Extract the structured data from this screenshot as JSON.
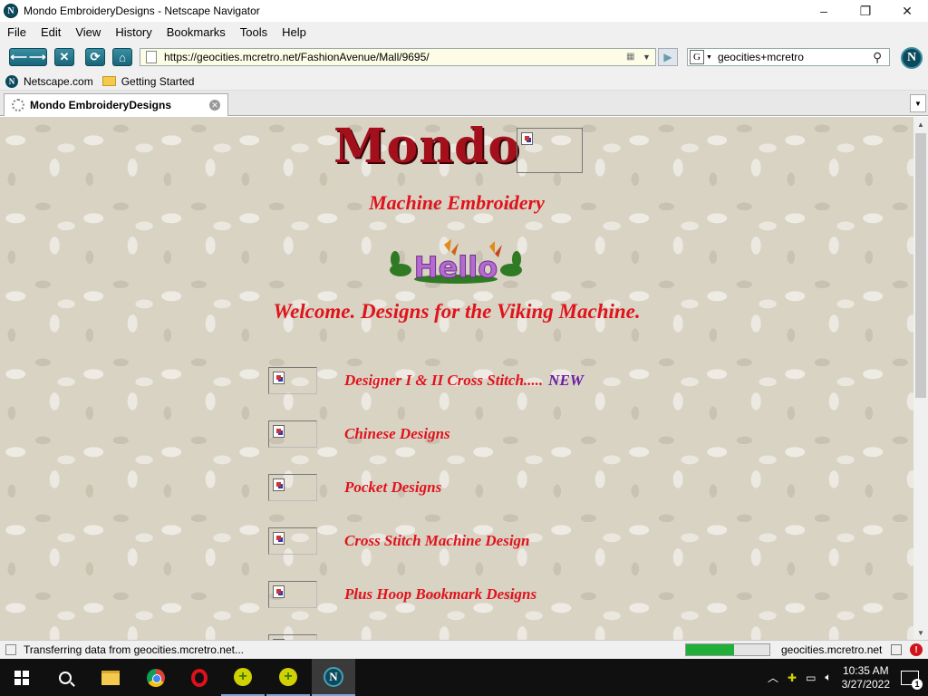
{
  "window": {
    "title": "Mondo EmbroideryDesigns - Netscape Navigator",
    "controls": [
      "–",
      "❐",
      "✕"
    ]
  },
  "menu": {
    "items": [
      "File",
      "Edit",
      "View",
      "History",
      "Bookmarks",
      "Tools",
      "Help"
    ]
  },
  "navigation": {
    "url": "https://geocities.mcretro.net/FashionAvenue/Mall/9695/",
    "search_engine": "G",
    "search_value": "geocities+mcretro"
  },
  "bookmarks": {
    "items": [
      {
        "label": "Netscape.com",
        "icon": "netscape-icon"
      },
      {
        "label": "Getting Started",
        "icon": "folder-icon"
      }
    ]
  },
  "tabs": [
    {
      "label": "Mondo EmbroideryDesigns",
      "loading": true
    }
  ],
  "page": {
    "logo_text": "Mondo",
    "subtitle": "Machine Embroidery",
    "hello_text": "Hello",
    "welcome": "Welcome. Designs for the Viking Machine.",
    "links": [
      {
        "label": "Designer I & II Cross Stitch.....",
        "badge": "NEW"
      },
      {
        "label": "Chinese Designs"
      },
      {
        "label": "Pocket Designs"
      },
      {
        "label": "Cross Stitch Machine Design"
      },
      {
        "label": "Plus Hoop Bookmark Designs"
      }
    ]
  },
  "status": {
    "text": "Transferring data from geocities.mcretro.net...",
    "progress": 0.58,
    "domain": "geocities.mcretro.net"
  },
  "taskbar": {
    "time": "10:35 AM",
    "date": "3/27/2022",
    "notification_count": "1"
  },
  "colors": {
    "link": "#e0131c",
    "new_badge": "#6b1aa3",
    "logo": "#a3101c",
    "page_background": "#d9d3c4"
  }
}
